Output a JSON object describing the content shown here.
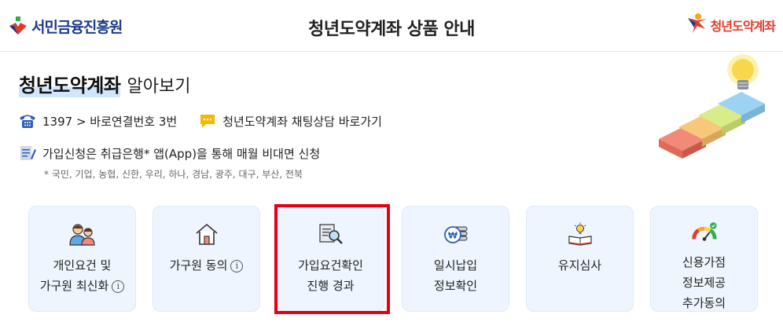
{
  "header": {
    "left_logo_text": "서민금융진흥원",
    "title": "청년도약계좌 상품 안내",
    "right_logo_text": "청년도약계좌"
  },
  "main": {
    "heading_strong": "청년도약계좌",
    "heading_light": "알아보기",
    "phone_text": "1397 > 바로연결번호 3번",
    "chat_link": "청년도약계좌 채팅상담 바로가기",
    "signup_text": "가입신청은 취급은행* 앱(App)을 통해 매월 비대면 신청",
    "banks_note": "* 국민, 기업, 농협, 신한, 우리, 하나, 경남, 광주, 대구, 부산, 전북"
  },
  "cards": [
    {
      "label": "개인요건 및\n가구원 최신화",
      "icon": "family-icon",
      "info": true
    },
    {
      "label": "가구원 동의",
      "icon": "house-icon",
      "info": true
    },
    {
      "label": "가입요건확인\n진행 경과",
      "icon": "document-search-icon",
      "info": false
    },
    {
      "label": "일시납입\n정보확인",
      "icon": "won-coin-icon",
      "info": false
    },
    {
      "label": "유지심사",
      "icon": "book-lightbulb-icon",
      "info": false
    },
    {
      "label": "신용가점\n정보제공\n추가동의",
      "icon": "gauge-icon",
      "info": false
    }
  ],
  "info_glyph": "i",
  "colors": {
    "brand_navy": "#1a3a8a",
    "brand_red": "#e23a2a",
    "card_bg": "#eef5fe",
    "highlight_red": "#e60012"
  }
}
